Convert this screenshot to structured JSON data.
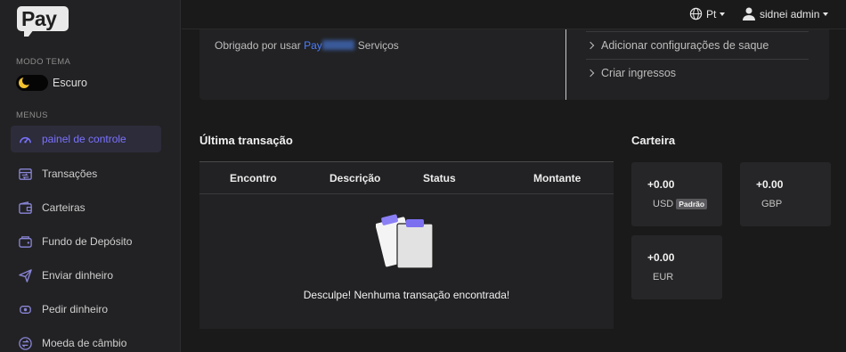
{
  "brand": {
    "logo_text": "Pay"
  },
  "sidebar": {
    "theme_section": "MODO TEMA",
    "theme_label": "Escuro",
    "menus_section": "MENUS",
    "items": [
      {
        "label": "painel de controle",
        "icon": "dashboard-icon",
        "active": true
      },
      {
        "label": "Transações",
        "icon": "transactions-icon"
      },
      {
        "label": "Carteiras",
        "icon": "wallet-icon"
      },
      {
        "label": "Fundo de Depósito",
        "icon": "deposit-icon"
      },
      {
        "label": "Enviar dinheiro",
        "icon": "send-icon"
      },
      {
        "label": "Pedir dinheiro",
        "icon": "request-money-icon"
      },
      {
        "label": "Moeda de câmbio",
        "icon": "exchange-icon"
      }
    ]
  },
  "topbar": {
    "language": "Pt",
    "user": "sidnei admin"
  },
  "welcome": {
    "prefix": "Obrigado por usar",
    "brand": "Pay",
    "suffix": "Serviços"
  },
  "quick_links": [
    {
      "label": "Adicionar configurações de saque"
    },
    {
      "label": "Criar ingressos"
    }
  ],
  "transactions": {
    "title": "Última transação",
    "columns": [
      "Encontro",
      "Descrição",
      "Status",
      "Montante"
    ],
    "empty_message": "Desculpe! Nenhuma transação encontrada!"
  },
  "wallets": {
    "title": "Carteira",
    "items": [
      {
        "amount": "+0.00",
        "currency": "USD",
        "badge": "Padrão"
      },
      {
        "amount": "+0.00",
        "currency": "GBP"
      },
      {
        "amount": "+0.00",
        "currency": "EUR"
      }
    ]
  },
  "colors": {
    "accent": "#7b72ff",
    "link": "#4a7dff",
    "background": "#1a1a1a",
    "card": "#222224"
  }
}
